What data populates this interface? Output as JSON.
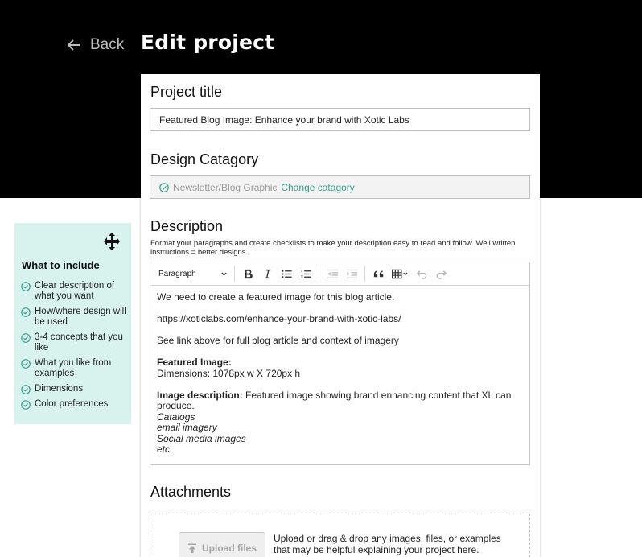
{
  "header": {
    "back_label": "Back",
    "title": "Edit project"
  },
  "form": {
    "title_label": "Project title",
    "title_value": "Featured Blog Image: Enhance your brand with Xotic Labs",
    "category_label": "Design Catagory",
    "category_value": "Newsletter/Blog Graphic",
    "category_change": "Change catagory",
    "description_label": "Description",
    "description_help": "Format your paragraphs and create checklists to make your description easy to read and follow. Well written instructions = better designs.",
    "attachments_label": "Attachments"
  },
  "editor": {
    "block_format": "Paragraph",
    "line1": "We need to create a featured image for this blog article.",
    "link": "https://xoticlabs.com/enhance-your-brand-with-xotic-labs/",
    "line3": "See link above for full blog article and context of imagery",
    "featured_label": "Featured Image:",
    "dimensions": "Dimensions: 1078px w X 720px h",
    "imgdesc_label": "Image description:",
    "imgdesc_text": " Featured image showing brand enhancing content that XL can produce.",
    "items": [
      "Catalogs",
      "email imagery",
      "Social media images",
      "etc."
    ]
  },
  "attachments": {
    "upload_label": "Upload files",
    "help": "Upload or drag & drop any images, files, or examples that may be helpful explaining your project here."
  },
  "sidebar": {
    "title": "What to include",
    "items": [
      "Clear description of what you want",
      "How/where design will be used",
      "3-4 concepts that you like",
      "What you like from examples",
      "Dimensions",
      "Color preferences"
    ]
  },
  "colors": {
    "accent": "#3a9e8f",
    "sidebar_bg": "#d8f3ee",
    "header_bg": "#000000"
  }
}
